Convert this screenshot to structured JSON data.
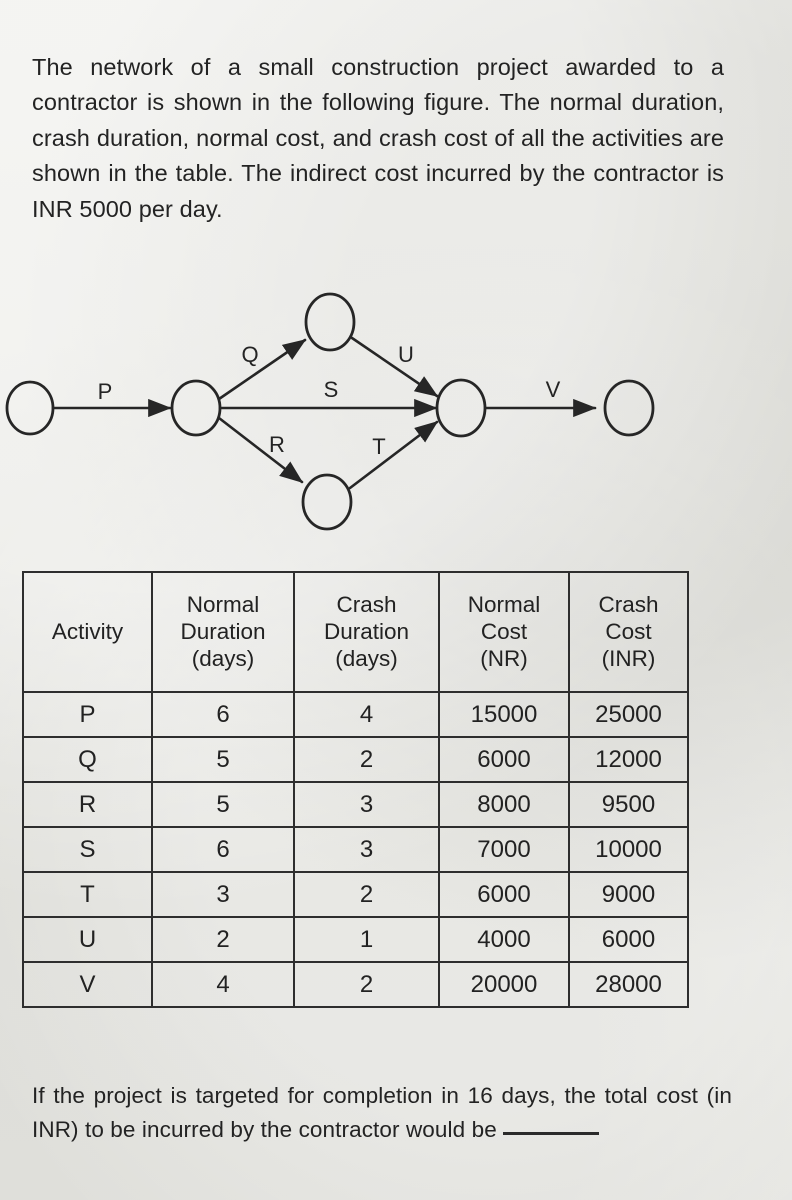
{
  "prompt": {
    "text": "The network of a small construction project awarded to a contractor is shown in the following figure. The normal duration, crash duration, normal cost, and crash cost of all the activities are shown in the table. The indirect cost incurred by the contractor is INR 5000 per day."
  },
  "question": {
    "text": "If the project is targeted for completion in 16 days, the total cost (in INR) to be incurred by the contractor would be"
  },
  "diagram": {
    "node_labels": [
      "",
      "",
      "",
      "",
      "",
      ""
    ],
    "edges": [
      {
        "label": "P",
        "from": "start",
        "to": "n2"
      },
      {
        "label": "Q",
        "from": "n2",
        "to": "n3-top"
      },
      {
        "label": "R",
        "from": "n2",
        "to": "n4-bottom"
      },
      {
        "label": "S",
        "from": "n2",
        "to": "n5-merge"
      },
      {
        "label": "T",
        "from": "n4-bottom",
        "to": "n5-merge"
      },
      {
        "label": "U",
        "from": "n3-top",
        "to": "n5-merge"
      },
      {
        "label": "V",
        "from": "n5-merge",
        "to": "end"
      }
    ],
    "ink_color": "#262626"
  },
  "table": {
    "headers": [
      {
        "lines": [
          "Activity"
        ]
      },
      {
        "lines": [
          "Normal",
          "Duration",
          "(days)"
        ]
      },
      {
        "lines": [
          "Crash",
          "Duration",
          "(days)"
        ]
      },
      {
        "lines": [
          "Normal",
          "Cost",
          "(NR)"
        ]
      },
      {
        "lines": [
          "Crash",
          "Cost",
          "(INR)"
        ]
      }
    ],
    "rows": [
      {
        "activity": "P",
        "normal_duration": "6",
        "crash_duration": "4",
        "normal_cost": "15000",
        "crash_cost": "25000"
      },
      {
        "activity": "Q",
        "normal_duration": "5",
        "crash_duration": "2",
        "normal_cost": "6000",
        "crash_cost": "12000"
      },
      {
        "activity": "R",
        "normal_duration": "5",
        "crash_duration": "3",
        "normal_cost": "8000",
        "crash_cost": "9500"
      },
      {
        "activity": "S",
        "normal_duration": "6",
        "crash_duration": "3",
        "normal_cost": "7000",
        "crash_cost": "10000"
      },
      {
        "activity": "T",
        "normal_duration": "3",
        "crash_duration": "2",
        "normal_cost": "6000",
        "crash_cost": "9000"
      },
      {
        "activity": "U",
        "normal_duration": "2",
        "crash_duration": "1",
        "normal_cost": "4000",
        "crash_cost": "6000"
      },
      {
        "activity": "V",
        "normal_duration": "4",
        "crash_duration": "2",
        "normal_cost": "20000",
        "crash_cost": "28000"
      }
    ]
  }
}
